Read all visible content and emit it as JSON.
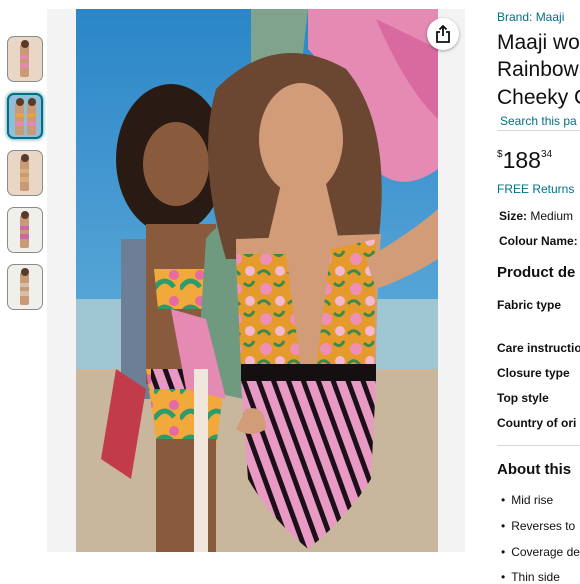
{
  "thumbnails": [
    {
      "label": "Image 1"
    },
    {
      "label": "Image 2",
      "selected": true
    },
    {
      "label": "Image 3"
    },
    {
      "label": "Image 4"
    },
    {
      "label": "Image 5"
    }
  ],
  "share_icon": "share-icon",
  "product": {
    "brand": "Brand: Maaji",
    "title_lines": [
      "Maaji wo",
      "Rainbow",
      "Cheeky C"
    ],
    "search_link": "Search this pa",
    "price": {
      "currency": "$",
      "whole": "188",
      "fraction": "34"
    },
    "returns": "FREE Returns",
    "size_label": "Size:",
    "size_value": "Medium",
    "colour_label": "Colour Name:",
    "details_heading": "Product de",
    "specs": [
      "Fabric type",
      "Care instructio",
      "Closure type",
      "Top style",
      "Country of ori"
    ],
    "about_heading": "About this",
    "bullets": [
      "Mid rise",
      "Reverses to",
      "Coverage de",
      "Thin side"
    ]
  },
  "colors": {
    "link": "#007185",
    "text": "#0F1111"
  }
}
